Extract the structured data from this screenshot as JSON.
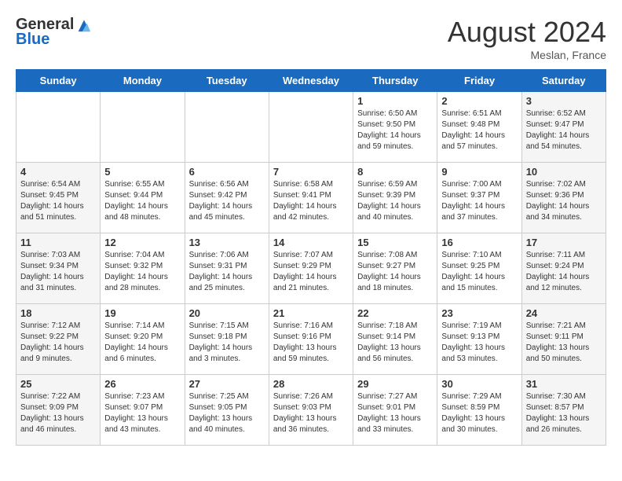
{
  "header": {
    "logo_line1": "General",
    "logo_line2": "Blue",
    "month": "August 2024",
    "location": "Meslan, France"
  },
  "weekdays": [
    "Sunday",
    "Monday",
    "Tuesday",
    "Wednesday",
    "Thursday",
    "Friday",
    "Saturday"
  ],
  "weeks": [
    [
      {
        "day": "",
        "info": ""
      },
      {
        "day": "",
        "info": ""
      },
      {
        "day": "",
        "info": ""
      },
      {
        "day": "",
        "info": ""
      },
      {
        "day": "1",
        "info": "Sunrise: 6:50 AM\nSunset: 9:50 PM\nDaylight: 14 hours and 59 minutes."
      },
      {
        "day": "2",
        "info": "Sunrise: 6:51 AM\nSunset: 9:48 PM\nDaylight: 14 hours and 57 minutes."
      },
      {
        "day": "3",
        "info": "Sunrise: 6:52 AM\nSunset: 9:47 PM\nDaylight: 14 hours and 54 minutes."
      }
    ],
    [
      {
        "day": "4",
        "info": "Sunrise: 6:54 AM\nSunset: 9:45 PM\nDaylight: 14 hours and 51 minutes."
      },
      {
        "day": "5",
        "info": "Sunrise: 6:55 AM\nSunset: 9:44 PM\nDaylight: 14 hours and 48 minutes."
      },
      {
        "day": "6",
        "info": "Sunrise: 6:56 AM\nSunset: 9:42 PM\nDaylight: 14 hours and 45 minutes."
      },
      {
        "day": "7",
        "info": "Sunrise: 6:58 AM\nSunset: 9:41 PM\nDaylight: 14 hours and 42 minutes."
      },
      {
        "day": "8",
        "info": "Sunrise: 6:59 AM\nSunset: 9:39 PM\nDaylight: 14 hours and 40 minutes."
      },
      {
        "day": "9",
        "info": "Sunrise: 7:00 AM\nSunset: 9:37 PM\nDaylight: 14 hours and 37 minutes."
      },
      {
        "day": "10",
        "info": "Sunrise: 7:02 AM\nSunset: 9:36 PM\nDaylight: 14 hours and 34 minutes."
      }
    ],
    [
      {
        "day": "11",
        "info": "Sunrise: 7:03 AM\nSunset: 9:34 PM\nDaylight: 14 hours and 31 minutes."
      },
      {
        "day": "12",
        "info": "Sunrise: 7:04 AM\nSunset: 9:32 PM\nDaylight: 14 hours and 28 minutes."
      },
      {
        "day": "13",
        "info": "Sunrise: 7:06 AM\nSunset: 9:31 PM\nDaylight: 14 hours and 25 minutes."
      },
      {
        "day": "14",
        "info": "Sunrise: 7:07 AM\nSunset: 9:29 PM\nDaylight: 14 hours and 21 minutes."
      },
      {
        "day": "15",
        "info": "Sunrise: 7:08 AM\nSunset: 9:27 PM\nDaylight: 14 hours and 18 minutes."
      },
      {
        "day": "16",
        "info": "Sunrise: 7:10 AM\nSunset: 9:25 PM\nDaylight: 14 hours and 15 minutes."
      },
      {
        "day": "17",
        "info": "Sunrise: 7:11 AM\nSunset: 9:24 PM\nDaylight: 14 hours and 12 minutes."
      }
    ],
    [
      {
        "day": "18",
        "info": "Sunrise: 7:12 AM\nSunset: 9:22 PM\nDaylight: 14 hours and 9 minutes."
      },
      {
        "day": "19",
        "info": "Sunrise: 7:14 AM\nSunset: 9:20 PM\nDaylight: 14 hours and 6 minutes."
      },
      {
        "day": "20",
        "info": "Sunrise: 7:15 AM\nSunset: 9:18 PM\nDaylight: 14 hours and 3 minutes."
      },
      {
        "day": "21",
        "info": "Sunrise: 7:16 AM\nSunset: 9:16 PM\nDaylight: 13 hours and 59 minutes."
      },
      {
        "day": "22",
        "info": "Sunrise: 7:18 AM\nSunset: 9:14 PM\nDaylight: 13 hours and 56 minutes."
      },
      {
        "day": "23",
        "info": "Sunrise: 7:19 AM\nSunset: 9:13 PM\nDaylight: 13 hours and 53 minutes."
      },
      {
        "day": "24",
        "info": "Sunrise: 7:21 AM\nSunset: 9:11 PM\nDaylight: 13 hours and 50 minutes."
      }
    ],
    [
      {
        "day": "25",
        "info": "Sunrise: 7:22 AM\nSunset: 9:09 PM\nDaylight: 13 hours and 46 minutes."
      },
      {
        "day": "26",
        "info": "Sunrise: 7:23 AM\nSunset: 9:07 PM\nDaylight: 13 hours and 43 minutes."
      },
      {
        "day": "27",
        "info": "Sunrise: 7:25 AM\nSunset: 9:05 PM\nDaylight: 13 hours and 40 minutes."
      },
      {
        "day": "28",
        "info": "Sunrise: 7:26 AM\nSunset: 9:03 PM\nDaylight: 13 hours and 36 minutes."
      },
      {
        "day": "29",
        "info": "Sunrise: 7:27 AM\nSunset: 9:01 PM\nDaylight: 13 hours and 33 minutes."
      },
      {
        "day": "30",
        "info": "Sunrise: 7:29 AM\nSunset: 8:59 PM\nDaylight: 13 hours and 30 minutes."
      },
      {
        "day": "31",
        "info": "Sunrise: 7:30 AM\nSunset: 8:57 PM\nDaylight: 13 hours and 26 minutes."
      }
    ]
  ]
}
